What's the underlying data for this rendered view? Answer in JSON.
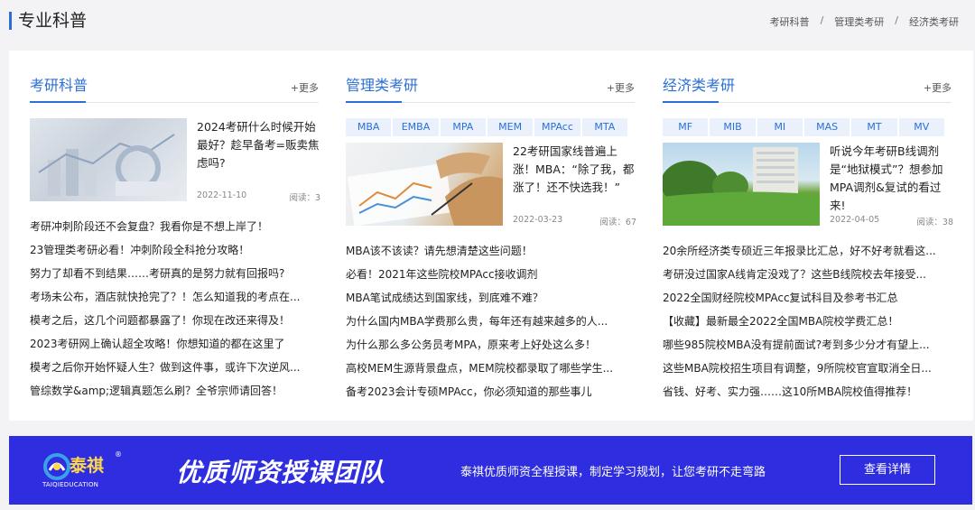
{
  "header": {
    "title": "专业科普",
    "breadcrumbs": [
      "考研科普",
      "管理类考研",
      "经济类考研"
    ],
    "separator": "/"
  },
  "columns": [
    {
      "title": "考研科普",
      "more": "+更多",
      "tags": [],
      "feature": {
        "title": "2024考研什么时候开始最好？趁早备考=贩卖焦虑吗?",
        "date": "2022-11-10",
        "reads": "阅读：3"
      },
      "items": [
        "考研冲刺阶段还不会复盘？我看你是不想上岸了！",
        "23管理类考研必看！冲刺阶段全科抢分攻略！",
        "努力了却看不到结果……考研真的是努力就有回报吗?",
        "考场未公布，酒店就快抢完了？！怎么知道我的考点在...",
        "模考之后，这几个问题都暴露了！你现在改还来得及！",
        "2023考研网上确认超全攻略！你想知道的都在这里了",
        "模考之后你开始怀疑人生？做到这件事，或许下次逆风...",
        "管综数学&amp;逻辑真题怎么刷？全爷宗师请回答！"
      ]
    },
    {
      "title": "管理类考研",
      "more": "+更多",
      "tags": [
        "MBA",
        "EMBA",
        "MPA",
        "MEM",
        "MPAcc",
        "MTA"
      ],
      "feature": {
        "title": "22考研国家线普遍上涨！MBA：“除了我，都涨了！还不快选我！”",
        "date": "2022-03-23",
        "reads": "阅读：67"
      },
      "items": [
        "MBA该不该读？请先想清楚这些问题！",
        "必看！2021年这些院校MPAcc接收调剂",
        "MBA笔试成绩达到国家线，到底难不难？",
        "为什么国内MBA学费那么贵，每年还有越来越多的人...",
        "为什么那么多公务员考MPA，原来考上好处这么多！",
        "高校MEM生源背景盘点，MEM院校都录取了哪些学生...",
        "备考2023会计专硕MPAcc，你必须知道的那些事儿"
      ]
    },
    {
      "title": "经济类考研",
      "more": "+更多",
      "tags": [
        "MF",
        "MIB",
        "MI",
        "MAS",
        "MT",
        "MV"
      ],
      "feature": {
        "title": "听说今年考研B线调剂是“地狱模式”？想参加MPA调剂&复试的看过来!",
        "date": "2022-04-05",
        "reads": "阅读：38"
      },
      "items": [
        "20余所经济类专硕近三年报录比汇总，好不好考就看这...",
        "考研没过国家A线肯定没戏了？这些B线院校去年接受...",
        "2022全国财经院校MPAcc复试科目及参考书汇总",
        "【收藏】最新最全2022全国MBA院校学费汇总！",
        "哪些985院校MBA没有提前面试?考到多少分才有望上...",
        "这些MBA院校招生项目有调整，9所院校官宣取消全日...",
        "省钱、好考、实力强……这10所MBA院校值得推荐！"
      ]
    }
  ],
  "banner": {
    "logo_text": "泰祺",
    "logo_sub": "TAIQIEDUCATION",
    "reg_mark": "®",
    "slogan": "优质师资授课团队",
    "description": "泰祺优质师资全程授课，制定学习规划，让您考研不走弯路",
    "button": "查看详情",
    "bg_color": "#2e2ee0"
  }
}
